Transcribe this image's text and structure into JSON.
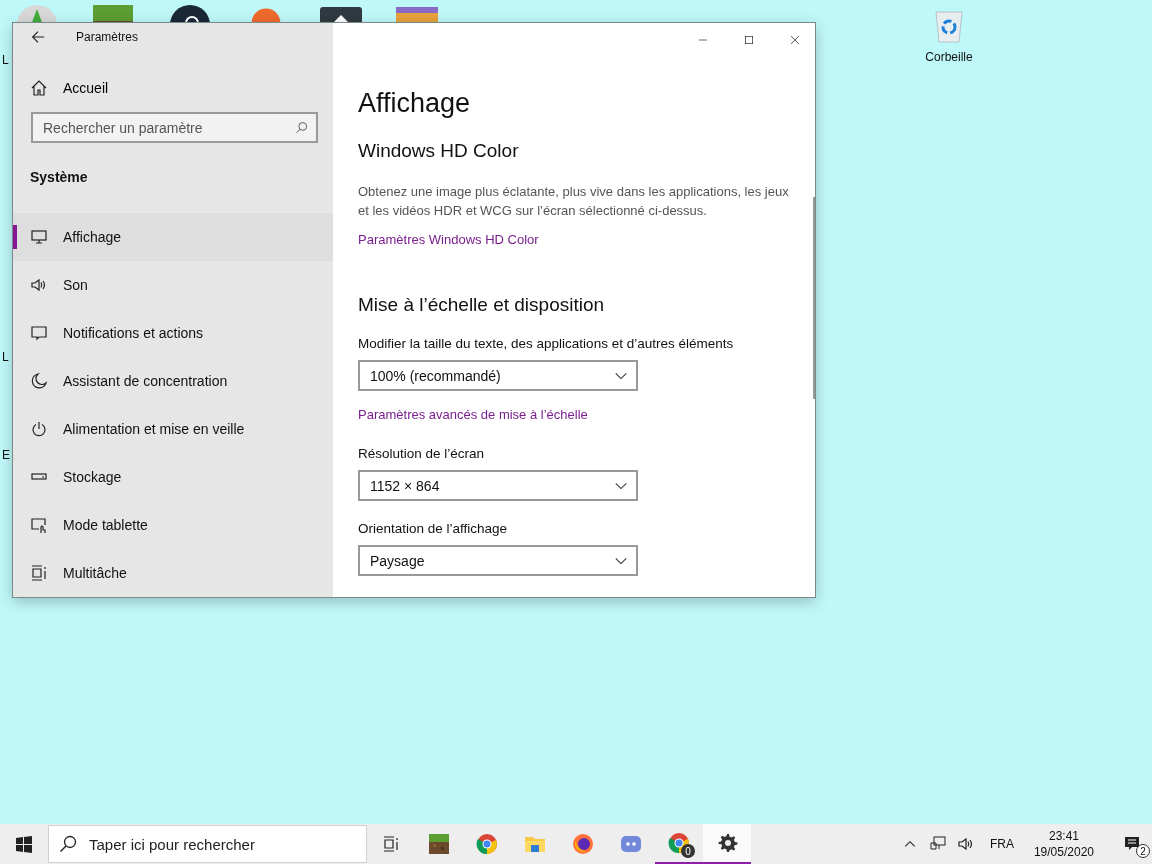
{
  "desktop": {
    "label_fragments": [
      "L",
      "L",
      "E"
    ],
    "recycle_bin": {
      "label": "Corbeille"
    }
  },
  "window": {
    "title": "Paramètres",
    "sidebar": {
      "home": "Accueil",
      "search": {
        "placeholder": "Rechercher un paramètre"
      },
      "section": "Système",
      "items": [
        {
          "label": "Affichage",
          "kind": "display",
          "selected": true
        },
        {
          "label": "Son",
          "kind": "sound",
          "selected": false
        },
        {
          "label": "Notifications et actions",
          "kind": "notifications",
          "selected": false
        },
        {
          "label": "Assistant de concentration",
          "kind": "focus",
          "selected": false
        },
        {
          "label": "Alimentation et mise en veille",
          "kind": "power",
          "selected": false
        },
        {
          "label": "Stockage",
          "kind": "storage",
          "selected": false
        },
        {
          "label": "Mode tablette",
          "kind": "tablet",
          "selected": false
        },
        {
          "label": "Multitâche",
          "kind": "multitask",
          "selected": false
        }
      ]
    },
    "content": {
      "title": "Affichage",
      "hd_color": {
        "heading": "Windows HD Color",
        "description": "Obtenez une image plus éclatante, plus vive dans les applications, les jeux et les vidéos HDR et WCG sur l’écran sélectionné ci-dessus.",
        "link": "Paramètres Windows HD Color"
      },
      "scale": {
        "heading": "Mise à l’échelle et disposition",
        "scale_label": "Modifier la taille du texte, des applications et d’autres éléments",
        "scale_value": "100% (recommandé)",
        "advanced_link": "Paramètres avancés de mise à l’échelle",
        "resolution_label": "Résolution de l’écran",
        "resolution_value": "1152 × 864",
        "orientation_label": "Orientation de l’affichage",
        "orientation_value": "Paysage"
      }
    }
  },
  "taskbar": {
    "search": {
      "placeholder": "Taper ici pour rechercher"
    },
    "apps": [
      {
        "kind": "grass-block",
        "running": false,
        "selected": false
      },
      {
        "kind": "browser",
        "running": false,
        "selected": false
      },
      {
        "kind": "folder",
        "running": false,
        "selected": false
      },
      {
        "kind": "fox-browser",
        "running": false,
        "selected": false
      },
      {
        "kind": "chat",
        "running": false,
        "selected": false
      },
      {
        "kind": "browser",
        "running": true,
        "selected": false,
        "badge": "0"
      },
      {
        "kind": "gear",
        "running": true,
        "selected": true
      }
    ],
    "tray": {
      "language": "FRA",
      "time": "23:41",
      "date": "19/05/2020",
      "notifications": "2"
    }
  }
}
